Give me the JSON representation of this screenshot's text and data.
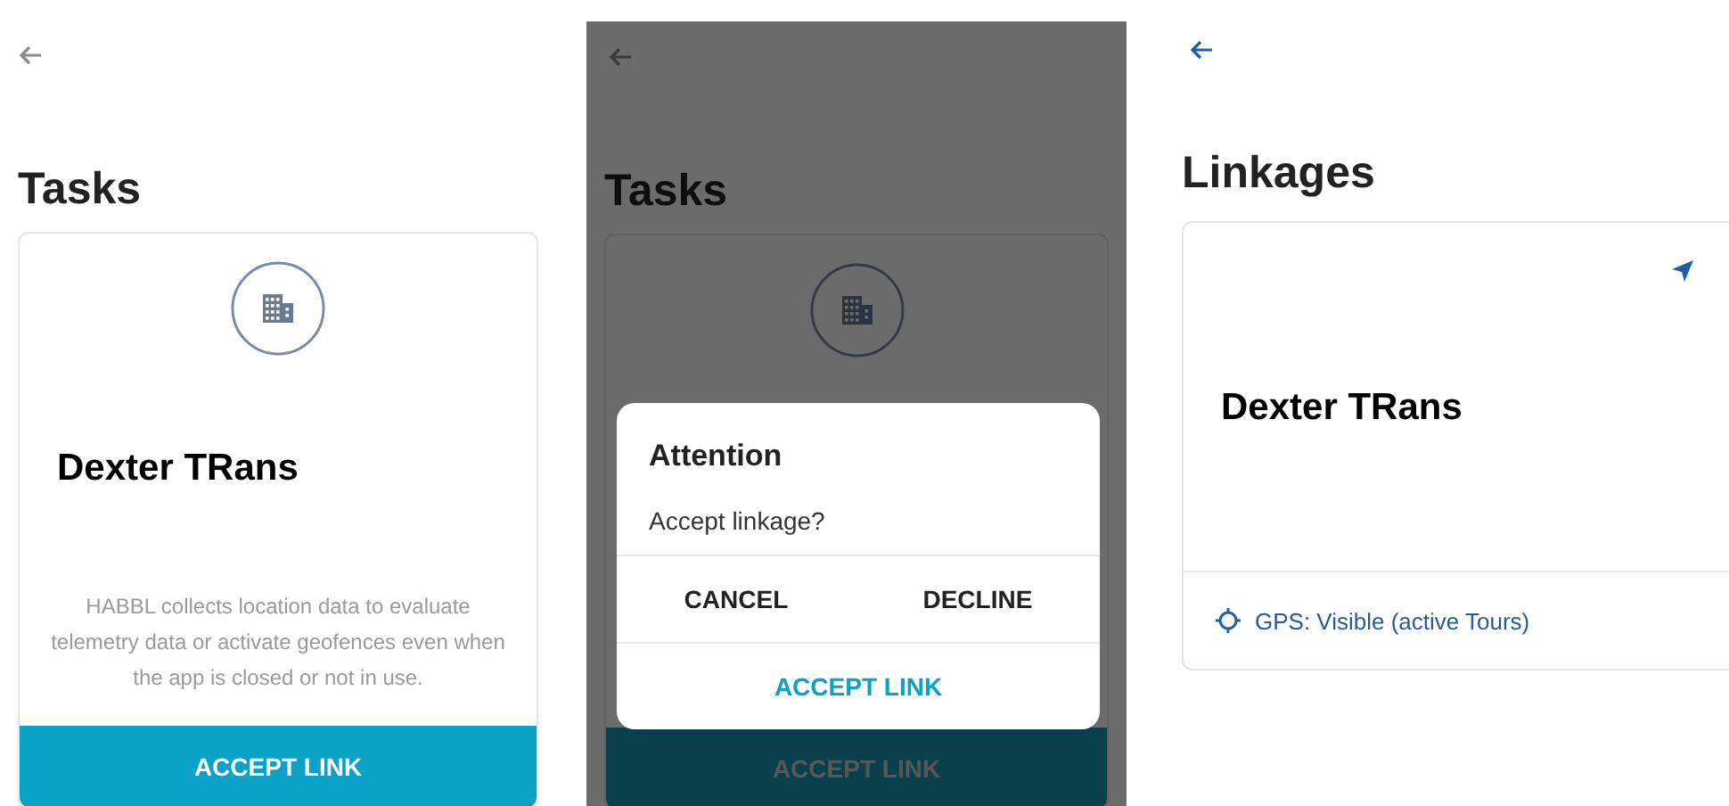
{
  "screens": [
    {
      "kind": "task",
      "dimmed": false,
      "title": "Tasks",
      "company": "Dexter TRans",
      "description": "HABBL collects location data to evaluate telemetry data or activate geofences even when the app is closed or not in use.",
      "button": "ACCEPT LINK"
    },
    {
      "kind": "task",
      "dimmed": true,
      "title": "Tasks",
      "button": "ACCEPT LINK",
      "dialog": {
        "title": "Attention",
        "message": "Accept linkage?",
        "actions": [
          {
            "label": "CANCEL"
          },
          {
            "label": "DECLINE"
          }
        ],
        "primary": "ACCEPT LINK"
      }
    },
    {
      "kind": "linkage",
      "dimmed": false,
      "title": "Linkages",
      "company": "Dexter TRans",
      "gps": "GPS: Visible (active Tours)"
    }
  ]
}
